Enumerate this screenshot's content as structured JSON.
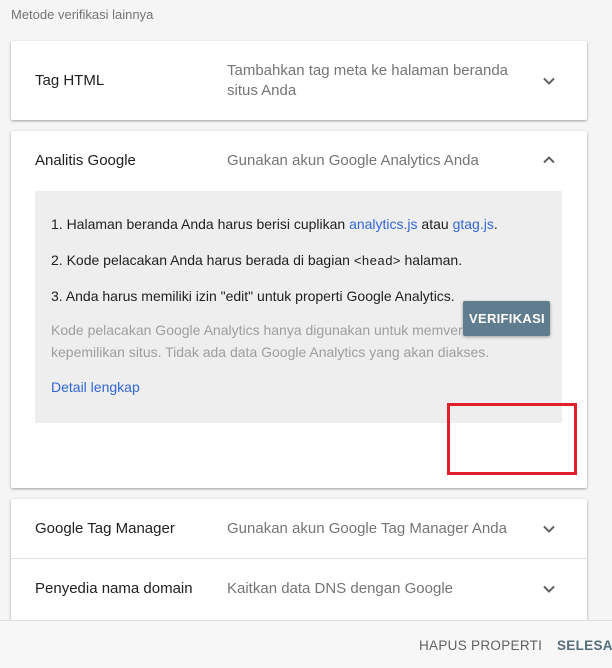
{
  "section_title": "Metode verifikasi lainnya",
  "methods": {
    "html_tag": {
      "title": "Tag HTML",
      "description": "Tambahkan tag meta ke halaman beranda situs Anda"
    },
    "analytics": {
      "title": "Analitis Google",
      "description": "Gunakan akun Google Analytics Anda",
      "step1_prefix": "1. Halaman beranda Anda harus berisi cuplikan ",
      "step1_link1": "analytics.js",
      "step1_mid": " atau ",
      "step1_link2": "gtag.js",
      "step1_suffix": ".",
      "step2_prefix": "2. Kode pelacakan Anda harus berada di bagian ",
      "step2_code": "<head>",
      "step2_suffix": " halaman.",
      "step3": "3. Anda harus memiliki izin \"edit\" untuk properti Google Analytics.",
      "note": "Kode pelacakan Google Analytics hanya digunakan untuk memverifikasi kepemilikan situs. Tidak ada data Google Analytics yang akan diakses.",
      "detail_link": "Detail lengkap",
      "verify_button": "VERIFIKASI"
    },
    "tag_manager": {
      "title": "Google Tag Manager",
      "description": "Gunakan akun Google Tag Manager Anda"
    },
    "domain": {
      "title": "Penyedia nama domain",
      "description": "Kaitkan data DNS dengan Google"
    }
  },
  "footer": {
    "remove_property": "HAPUS PROPERTI",
    "done": "SELESAI"
  },
  "colors": {
    "link": "#3367d6",
    "verify_button": "#5f7d8e",
    "highlight_box": "#e0202a"
  }
}
